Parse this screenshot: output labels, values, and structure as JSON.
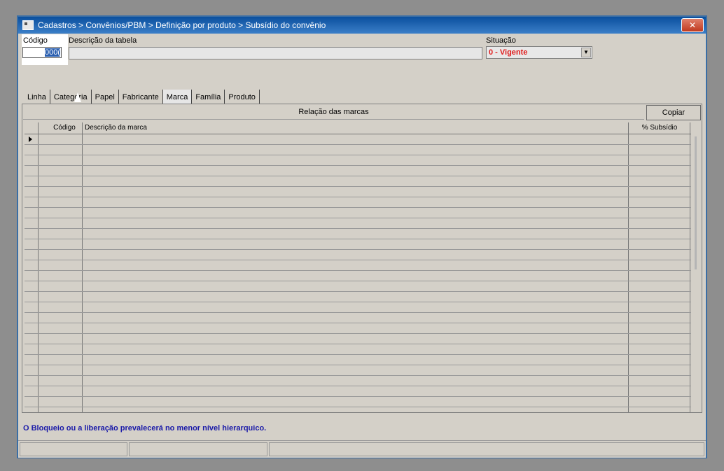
{
  "window": {
    "title": "Cadastros > Convênios/PBM > Definição por produto > Subsídio do convênio",
    "close_symbol": "✕"
  },
  "form": {
    "codigo_label": "Código",
    "codigo_value": "000(",
    "descricao_label": "Descrição da tabela",
    "descricao_value": "",
    "situacao_label": "Situação",
    "situacao_value": "0 - Vigente",
    "situacao_arrow": "▼"
  },
  "tabs": [
    "Linha",
    "Categoria",
    "Papel",
    "Fabricante",
    "Marca",
    "Família",
    "Produto"
  ],
  "active_tab": "Marca",
  "panel": {
    "header": "Relação das marcas",
    "copy_button": "Copiar"
  },
  "grid": {
    "columns": [
      "Código",
      "Descrição da marca",
      "% Subsídio"
    ],
    "row_count": 26
  },
  "info_text": "O Bloqueio ou a liberação prevalecerá no menor nível hierarquico.",
  "colors": {
    "accent": "#1a1aa8",
    "status_red": "#e01a1a",
    "window_bg": "#d4d0c8"
  }
}
